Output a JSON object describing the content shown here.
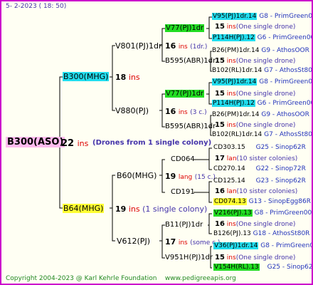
{
  "header": {
    "date": "5-  2-2023 ( 18: 50)"
  },
  "footer": {
    "copyright": "Copyright 2004-2023 @ Karl Kehrle Foundation",
    "site": "www.pedigreeapis.org"
  },
  "root": {
    "name": "B300(ASO)",
    "inbreeding": "22",
    "ins": "ins",
    "note": "(Drones from 1 single colony)"
  },
  "gen1": {
    "upper": {
      "name": "B300(MHG)",
      "num": "18",
      "ins": "ins"
    },
    "lower": {
      "name": "B64(MHG)",
      "num": "19",
      "ins": "ins",
      "note": "(1 single colony)"
    }
  },
  "gen2": {
    "v801": {
      "name": "V801(PJ)1dr",
      "num": "16",
      "ins": "ins",
      "note": "(1dr.)"
    },
    "v880": {
      "name": "V880(PJ)",
      "num": "16",
      "ins": "ins",
      "note": "(3 c.)"
    },
    "b60": {
      "name": "B60(MHG)",
      "num": "19",
      "ins": "lang",
      "note": "(15 c.)"
    },
    "v612": {
      "name": "V612(PJ)",
      "num": "17",
      "ins": "ins",
      "note": "(some c.)"
    }
  },
  "gen3": {
    "v77a": {
      "name": "V77(PJ)1dr"
    },
    "b595a": {
      "name": "B595(ABR)1dr"
    },
    "v77b": {
      "name": "V77(PJ)1dr"
    },
    "b595b": {
      "name": "B595(ABR)1dr"
    },
    "cd064": {
      "name": "CD064"
    },
    "cd191": {
      "name": "CD191"
    },
    "b11": {
      "name": "B11(PJ)1dr"
    },
    "v951h": {
      "name": "V951H(PJ)1dr"
    }
  },
  "gen4": [
    {
      "name": "V95(PJ)1dr.14",
      "source": "G8 - PrimGreen00"
    },
    {
      "num": "15",
      "ins": "ins",
      "note": "(One single drone)"
    },
    {
      "name": "P114H(PJ).12",
      "source": "G6 - PrimGreen00"
    },
    {
      "name": "B26(PM)1dr.14",
      "source": "G9 - AthosOOR"
    },
    {
      "num": "15",
      "ins": "ins",
      "note": "(One single drone)"
    },
    {
      "name": "B102(RL)1dr.14",
      "source": "G7 - AthosSt80R"
    },
    {
      "name": "V95(PJ)1dr.14",
      "source": "G8 - PrimGreen00"
    },
    {
      "num": "15",
      "ins": "ins",
      "note": "(One single drone)"
    },
    {
      "name": "P114H(PJ).12",
      "source": "G6 - PrimGreen00"
    },
    {
      "name": "B26(PM)1dr.14",
      "source": "G9 - AthosOOR"
    },
    {
      "num": "15",
      "ins": "ins",
      "note": "(One single drone)"
    },
    {
      "name": "B102(RL)1dr.14",
      "source": "G7 - AthosSt80R"
    },
    {
      "name": "CD303.15",
      "source": "G25 - Sinop62R"
    },
    {
      "num": "17",
      "ins": "lan",
      "note": "(10 sister colonies)"
    },
    {
      "name": "CD270.14",
      "source": "G22 - Sinop72R"
    },
    {
      "name": "CD125.14",
      "source": "G23 - Sinop62R"
    },
    {
      "num": "16",
      "ins": "lan",
      "note": "(10 sister colonies)"
    },
    {
      "name": "CD074.13",
      "source": "G13 - SinopEgg86R"
    },
    {
      "name": "V216(PJ).13",
      "source": "G8 - PrimGreen00"
    },
    {
      "num": "16",
      "ins": "ins",
      "note": "(One single drone)"
    },
    {
      "name": "B126(PJ).13",
      "source": "G18 - AthosSt80R"
    },
    {
      "name": "V36(PJ)1dr.14",
      "source": "G8 - PrimGreen00"
    },
    {
      "num": "15",
      "ins": "ins",
      "note": "(One single drone)"
    },
    {
      "name": "V154H(RL).13",
      "source": "G25 - Sinop62R"
    }
  ]
}
